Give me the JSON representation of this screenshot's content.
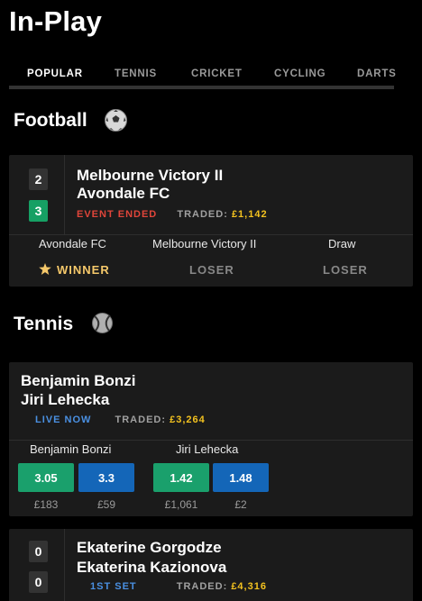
{
  "header": {
    "title": "In-Play"
  },
  "tabs": [
    {
      "label": "POPULAR",
      "active": true
    },
    {
      "label": "TENNIS"
    },
    {
      "label": "CRICKET"
    },
    {
      "label": "CYCLING"
    },
    {
      "label": "DARTS"
    }
  ],
  "sections": {
    "football": {
      "title": "Football",
      "icon": "football-icon",
      "match": {
        "score_home": "2",
        "score_away": "3",
        "team_home": "Melbourne Victory II",
        "team_away": "Avondale FC",
        "status": "EVENT ENDED",
        "traded_label": "TRADED:",
        "traded_value": "£1,142",
        "runners": [
          {
            "name": "Avondale FC",
            "result": "WINNER",
            "icon": "star-icon"
          },
          {
            "name": "Melbourne Victory II",
            "result": "LOSER"
          },
          {
            "name": "Draw",
            "result": "LOSER"
          }
        ]
      }
    },
    "tennis": {
      "title": "Tennis",
      "icon": "tennis-ball-icon",
      "match1": {
        "player1": "Benjamin Bonzi",
        "player2": "Jiri Lehecka",
        "status": "LIVE NOW",
        "traded_label": "TRADED:",
        "traded_value": "£3,264",
        "runners": [
          {
            "name": "Benjamin Bonzi",
            "back": "3.05",
            "back_vol": "£183",
            "lay": "3.3",
            "lay_vol": "£59"
          },
          {
            "name": "Jiri Lehecka",
            "back": "1.42",
            "back_vol": "£1,061",
            "lay": "1.48",
            "lay_vol": "£2"
          }
        ]
      },
      "match2": {
        "score1": "0",
        "score2": "0",
        "player1": "Ekaterine Gorgodze",
        "player2": "Ekaterina Kazionova",
        "status": "1ST SET",
        "traded_label": "TRADED:",
        "traded_value": "£4,316"
      }
    }
  },
  "colors": {
    "back": "#1aa06c",
    "lay": "#1466b8",
    "traded": "#f3c21f",
    "ended": "#e0453a",
    "live": "#4a90e2",
    "winner": "#f5c86a"
  }
}
